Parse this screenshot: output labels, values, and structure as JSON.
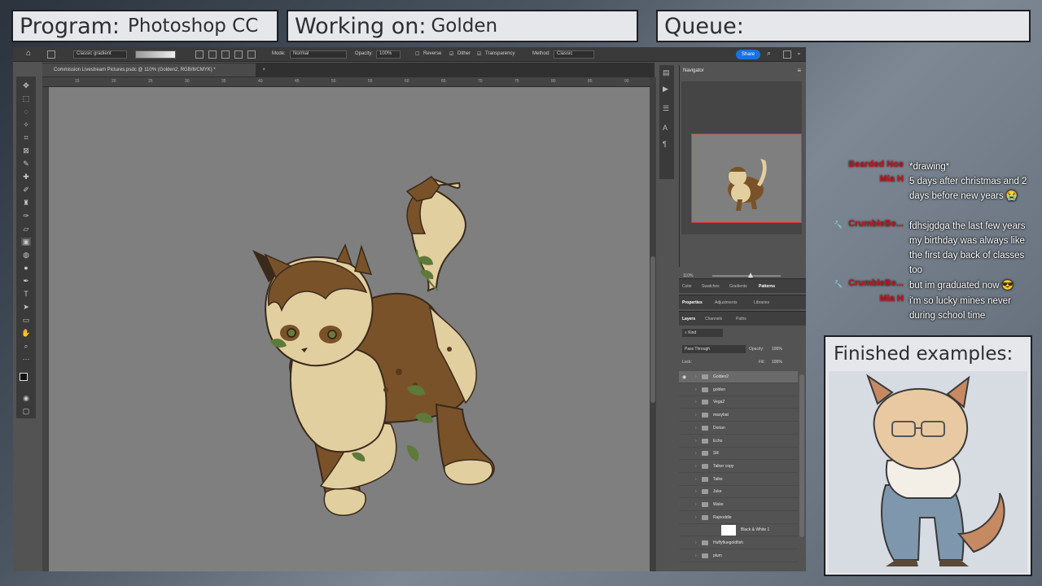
{
  "overlay": {
    "program_label": "Program:",
    "program_value": "Photoshop CC",
    "working_label": "Working on:",
    "working_value": "Golden",
    "queue_label": "Queue:",
    "finished_title": "Finished examples:"
  },
  "photoshop": {
    "options_bar": {
      "gradient_preset": "Classic gradient",
      "mode_label": "Mode:",
      "mode_value": "Normal",
      "opacity_label": "Opacity:",
      "opacity_value": "100%",
      "reverse_label": "Reverse",
      "dither_label": "Dither",
      "transparency_label": "Transparency",
      "method_label": "Method:",
      "method_value": "Classic",
      "share_label": "Share"
    },
    "document_tab": "Commission Livestream Pictures.psdc @ 110% (Golden2, RGB/8/CMYK) *",
    "ruler_ticks": [
      "15",
      "20",
      "25",
      "30",
      "35",
      "40",
      "45",
      "50",
      "55",
      "60",
      "65",
      "70",
      "75",
      "80",
      "85",
      "90",
      "95"
    ],
    "navigator": {
      "title": "Navigator",
      "zoom": "110%"
    },
    "panel_tabs_1": [
      "Color",
      "Swatches",
      "Gradients",
      "Patterns"
    ],
    "panel_tabs_1_active": "Patterns",
    "panel_tabs_2": [
      "Properties",
      "Adjustments",
      "Libraries"
    ],
    "panel_tabs_2_active": "Properties",
    "panel_tabs_3": [
      "Layers",
      "Channels",
      "Paths"
    ],
    "panel_tabs_3_active": "Layers",
    "layers_filter": "Kind",
    "blend_mode": "Pass Through",
    "opacity_label": "Opacity:",
    "opacity_value": "100%",
    "lock_label": "Lock:",
    "fill_label": "Fill:",
    "fill_value": "100%",
    "layers": [
      {
        "name": "Golden2",
        "selected": true
      },
      {
        "name": "golden",
        "selected": false
      },
      {
        "name": "Vega2",
        "selected": false
      },
      {
        "name": "maxybat",
        "selected": false
      },
      {
        "name": "Dorian",
        "selected": false
      },
      {
        "name": "Echo",
        "selected": false
      },
      {
        "name": "Sill",
        "selected": false
      },
      {
        "name": "Talker copy",
        "selected": false
      },
      {
        "name": "Talke",
        "selected": false
      },
      {
        "name": "Juke",
        "selected": false
      },
      {
        "name": "Wake",
        "selected": false
      },
      {
        "name": "Rajnoddle",
        "selected": false
      },
      {
        "name": "Black & White 1",
        "selected": false
      },
      {
        "name": "Huffyfluegoldfish",
        "selected": false
      },
      {
        "name": "plum",
        "selected": false
      }
    ]
  },
  "chat": [
    {
      "user": "Bearded Noe",
      "message": "*drawing*"
    },
    {
      "user": "Mia H",
      "message": "5 days after christmas and 2 days before new years 😭"
    },
    {
      "user": "CrumbleBe...",
      "message": "fdhsjgdga the last few years my birthday was always like the first day back of classes too"
    },
    {
      "user": "CrumbleBe...",
      "message": "but im graduated now 😎"
    },
    {
      "user": "Mia H",
      "message": "i'm so lucky mines never during school time"
    }
  ],
  "colors": {
    "overlay_bg": "#e6e7ea",
    "ps_bg": "#535353",
    "canvas": "#7f7f7f",
    "chat_user": "#c8151d",
    "share": "#1473e6",
    "nav_frame": "#e0303b"
  }
}
